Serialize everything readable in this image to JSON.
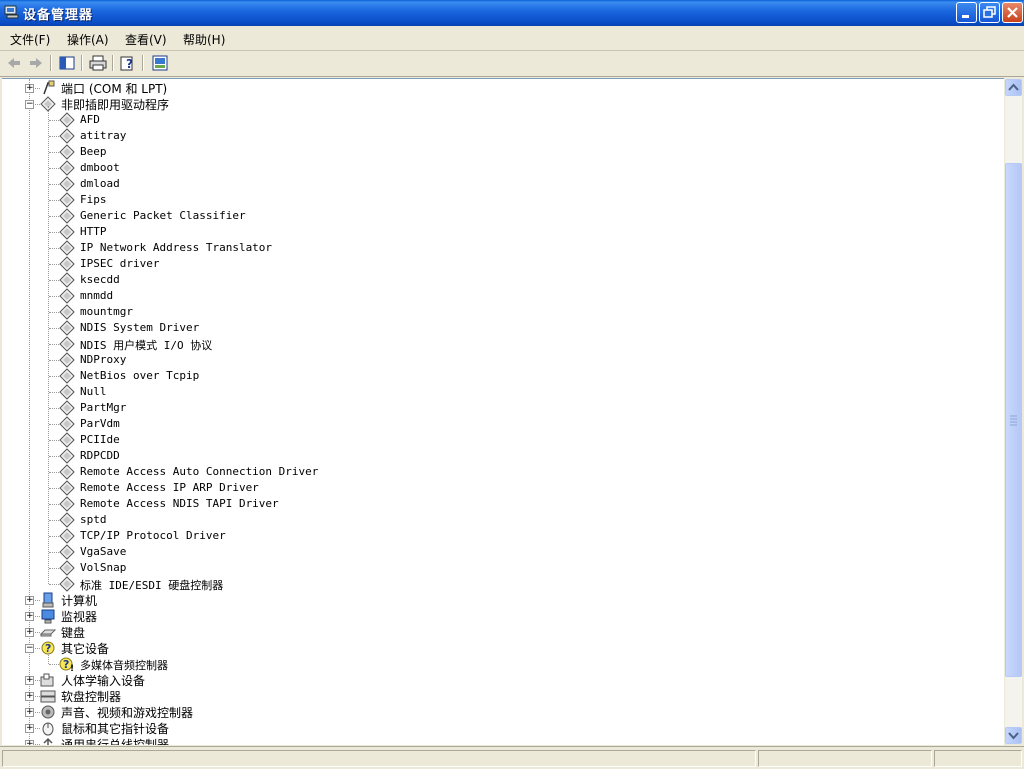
{
  "window": {
    "title": "设备管理器"
  },
  "menu": [
    {
      "label": "文件(F)"
    },
    {
      "label": "操作(A)"
    },
    {
      "label": "查看(V)"
    },
    {
      "label": "帮助(H)"
    }
  ],
  "toolbar": {
    "buttons": [
      "back-arrow-icon",
      "forward-arrow-icon",
      "show-hide-console-tree-icon",
      "print-icon",
      "help-icon",
      "properties-icon"
    ]
  },
  "tree": {
    "ports": {
      "label": "端口 (COM 和 LPT)",
      "expander": "+"
    },
    "non_pnp": {
      "label": "非即插即用驱动程序",
      "expander": "−"
    },
    "non_pnp_items": [
      "AFD",
      "atitray",
      "Beep",
      "dmboot",
      "dmload",
      "Fips",
      "Generic Packet Classifier",
      "HTTP",
      "IP Network Address Translator",
      "IPSEC driver",
      "ksecdd",
      "mnmdd",
      "mountmgr",
      "NDIS System Driver",
      "NDIS 用户模式 I/O 协议",
      "NDProxy",
      "NetBios over Tcpip",
      "Null",
      "PartMgr",
      "ParVdm",
      "PCIIde",
      "RDPCDD",
      "Remote Access Auto Connection Driver",
      "Remote Access IP ARP Driver",
      "Remote Access NDIS TAPI Driver",
      "sptd",
      "TCP/IP Protocol Driver",
      "VgaSave",
      "VolSnap",
      "标准 IDE/ESDI 硬盘控制器"
    ],
    "computer": {
      "label": "计算机",
      "expander": "+"
    },
    "monitors": {
      "label": "监视器",
      "expander": "+"
    },
    "keyboards": {
      "label": "键盘",
      "expander": "+"
    },
    "other": {
      "label": "其它设备",
      "expander": "−"
    },
    "other_items": [
      "多媒体音频控制器"
    ],
    "hid": {
      "label": "人体学输入设备",
      "expander": "+"
    },
    "floppy": {
      "label": "软盘控制器",
      "expander": "+"
    },
    "sound": {
      "label": "声音、视频和游戏控制器",
      "expander": "+"
    },
    "mice": {
      "label": "鼠标和其它指针设备",
      "expander": "+"
    },
    "usb": {
      "label": "通用串行总线控制器",
      "expander": "+"
    }
  },
  "colors": {
    "title_bar": "#0a4ec8",
    "window_bg": "#ece9d8",
    "tree_bg": "#ffffff"
  }
}
